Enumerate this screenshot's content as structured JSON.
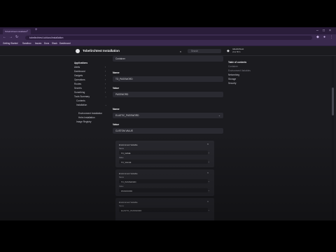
{
  "browser": {
    "tab_title": "Tobelirchtest installation",
    "tab_close_icon": "close-icon",
    "url": "tobelirchtest.io/docs/installation",
    "bookmarks": [
      "Getting Started",
      "Sandbox",
      "Issues",
      "Docs",
      "Slack",
      "Dashboard"
    ],
    "accent": "#3a2a4e"
  },
  "header": {
    "title": "Tobelirchtest Installation",
    "search_placeholder": "Search",
    "repo_line1": "tobelirchtest",
    "repo_line2": "v1.2  ★ 1"
  },
  "sidebar": {
    "items": [
      {
        "label": "Applications",
        "heading": true,
        "chev": false
      },
      {
        "label": "Alerts",
        "heading": false,
        "chev": true
      },
      {
        "label": "Dashboard",
        "heading": false,
        "chev": true
      },
      {
        "label": "Gadgets",
        "heading": false,
        "chev": true
      },
      {
        "label": "Operations",
        "heading": false,
        "chev": true
      },
      {
        "label": "Routes",
        "heading": false,
        "chev": true
      },
      {
        "label": "Secrets",
        "heading": false,
        "chev": true
      },
      {
        "label": "Something",
        "heading": false,
        "chev": true
      },
      {
        "label": "Tools Summary",
        "heading": false,
        "chev": true
      },
      {
        "label": "Contents",
        "heading": false,
        "chev": false,
        "indent": 1
      },
      {
        "label": "Installation",
        "heading": false,
        "chev": true,
        "indent": 1
      },
      {
        "label": "Environment Installation",
        "heading": false,
        "chev": false,
        "indent": 2
      },
      {
        "label": "Helm Installation",
        "heading": false,
        "chev": false,
        "indent": 2
      },
      {
        "label": "Image Registry",
        "heading": false,
        "chev": false,
        "indent": 0
      }
    ]
  },
  "main": {
    "top_pill": "Container",
    "name1_label": "Name",
    "name1_value": "TO_PASSWORD",
    "value1_label": "Value",
    "value1_value": "PASSWORD",
    "name2_label": "Name",
    "name2_value": "ELASTIC_PASSWORD",
    "value2_label": "Value",
    "value2_value": "CUSTOM VALUE",
    "cards": [
      {
        "title": "Environment Variable",
        "name_label": "Name",
        "name_value": "TO_NAME",
        "value_label": "Value",
        "value_value": "TO_VALUE"
      },
      {
        "title": "Environment Variable",
        "name_label": "Name",
        "name_value": "TO_PASSWORD",
        "value_label": "Value",
        "value_value": "PASSWORD"
      },
      {
        "title": "Environment Variable",
        "name_label": "Name",
        "name_value": "ELASTIC_PASSWORD",
        "value_label": "Value",
        "value_value": ""
      }
    ]
  },
  "toc": {
    "heading": "Table of contents",
    "items": [
      {
        "label": "Container",
        "dim": true
      },
      {
        "label": "Environment Variables",
        "dim": true
      },
      {
        "label": "Networking",
        "dim": false
      },
      {
        "label": "Storage",
        "dim": false
      },
      {
        "label": "Security",
        "dim": false
      }
    ]
  }
}
